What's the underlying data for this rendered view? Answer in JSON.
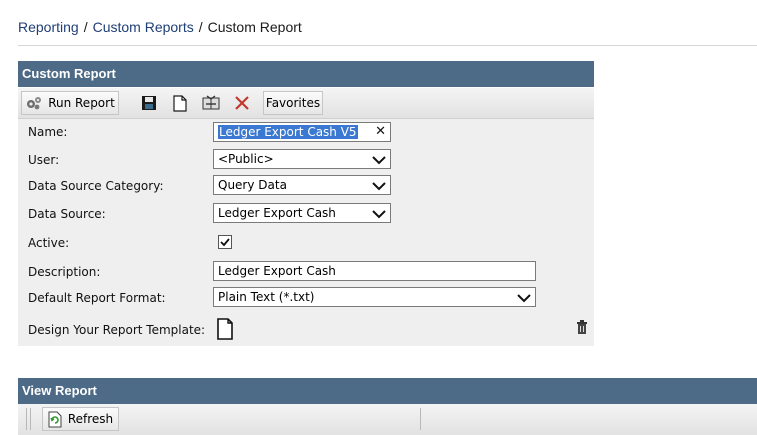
{
  "breadcrumb": {
    "items": [
      "Reporting",
      "Custom Reports",
      "Custom Report"
    ],
    "separator": "/"
  },
  "custom_report": {
    "title": "Custom Report",
    "toolbar": {
      "run_report_label": "Run Report",
      "favorites_label": "Favorites",
      "icons": [
        "gears-icon",
        "save-icon",
        "new-document-icon",
        "copy-icon",
        "delete-icon"
      ]
    },
    "fields": {
      "name": {
        "label": "Name:",
        "value": "Ledger Export Cash V5"
      },
      "user": {
        "label": "User:",
        "value": "<Public>"
      },
      "data_source_category": {
        "label": "Data Source Category:",
        "value": "Query Data"
      },
      "data_source": {
        "label": "Data Source:",
        "value": "Ledger Export Cash"
      },
      "active": {
        "label": "Active:",
        "checked": true
      },
      "description": {
        "label": "Description:",
        "value": "Ledger Export Cash"
      },
      "default_report_format": {
        "label": "Default Report Format:",
        "value": "Plain Text (*.txt)"
      },
      "design_template": {
        "label": "Design Your Report Template:"
      }
    }
  },
  "view_report": {
    "title": "View Report",
    "refresh_label": "Refresh"
  },
  "colors": {
    "header_bg": "#4d6a86",
    "link": "#1f3f75",
    "selection": "#3a78d1",
    "delete_red": "#c0392b"
  }
}
